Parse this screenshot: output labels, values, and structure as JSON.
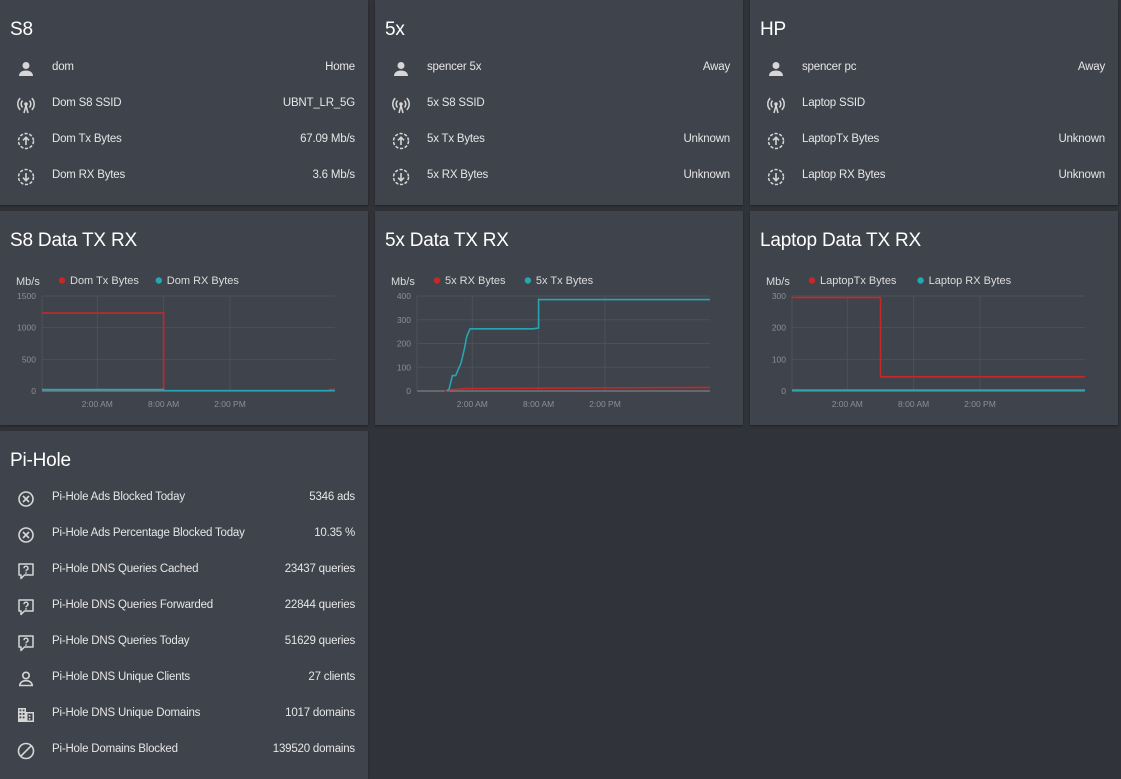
{
  "colors": {
    "tx": "#c62828",
    "rx": "#26a6b1",
    "grid": "#4c5058",
    "axis": "#8a8d93"
  },
  "cards": {
    "s8": {
      "title": "S8",
      "rows": [
        {
          "icon": "person-icon",
          "label": "dom",
          "value": "Home"
        },
        {
          "icon": "wifi-icon",
          "label": "Dom S8 SSID",
          "value": "UBNT_LR_5G"
        },
        {
          "icon": "upload-icon",
          "label": "Dom Tx Bytes",
          "value": "67.09 Mb/s"
        },
        {
          "icon": "download-icon",
          "label": "Dom RX Bytes",
          "value": "3.6 Mb/s"
        }
      ]
    },
    "fivex": {
      "title": "5x",
      "rows": [
        {
          "icon": "person-icon",
          "label": "spencer 5x",
          "value": "Away"
        },
        {
          "icon": "wifi-icon",
          "label": "5x S8 SSID",
          "value": ""
        },
        {
          "icon": "upload-icon",
          "label": "5x Tx Bytes",
          "value": "Unknown"
        },
        {
          "icon": "download-icon",
          "label": "5x RX Bytes",
          "value": "Unknown"
        }
      ]
    },
    "hp": {
      "title": "HP",
      "rows": [
        {
          "icon": "person-icon",
          "label": "spencer pc",
          "value": "Away"
        },
        {
          "icon": "wifi-icon",
          "label": "Laptop SSID",
          "value": ""
        },
        {
          "icon": "upload-icon",
          "label": "LaptopTx Bytes",
          "value": "Unknown"
        },
        {
          "icon": "download-icon",
          "label": "Laptop RX Bytes",
          "value": "Unknown"
        }
      ]
    },
    "pihole": {
      "title": "Pi-Hole",
      "rows": [
        {
          "icon": "block-circle-icon",
          "label": "Pi-Hole Ads Blocked Today",
          "value": "5346 ads"
        },
        {
          "icon": "block-circle-icon",
          "label": "Pi-Hole Ads Percentage Blocked Today",
          "value": "10.35 %"
        },
        {
          "icon": "question-bubble-icon",
          "label": "Pi-Hole DNS Queries Cached",
          "value": "23437 queries"
        },
        {
          "icon": "question-bubble-icon",
          "label": "Pi-Hole DNS Queries Forwarded",
          "value": "22844 queries"
        },
        {
          "icon": "question-bubble-icon",
          "label": "Pi-Hole DNS Queries Today",
          "value": "51629 queries"
        },
        {
          "icon": "person-outline-icon",
          "label": "Pi-Hole DNS Unique Clients",
          "value": "27 clients"
        },
        {
          "icon": "domain-icon",
          "label": "Pi-Hole DNS Unique Domains",
          "value": "1017 domains"
        },
        {
          "icon": "cancel-icon",
          "label": "Pi-Hole Domains Blocked",
          "value": "139520 domains"
        }
      ]
    }
  },
  "chart_data": [
    {
      "type": "line",
      "title": "S8 Data TX RX",
      "ylabel": "Mb/s",
      "x_axis": "time",
      "x_ticks": [
        "2:00 AM",
        "8:00 AM",
        "2:00 PM"
      ],
      "x_tick_hours": [
        2,
        8,
        14
      ],
      "x_range_hours": [
        -3,
        23.5
      ],
      "ylim": [
        0,
        1500
      ],
      "y_ticks": [
        0,
        500,
        1000,
        1500
      ],
      "series": [
        {
          "name": "Dom Tx Bytes",
          "color": "tx",
          "points": [
            [
              -3,
              1230
            ],
            [
              8,
              1230
            ],
            [
              8,
              0
            ],
            [
              23,
              0
            ],
            [
              23,
              25
            ],
            [
              23.5,
              25
            ]
          ]
        },
        {
          "name": "Dom RX Bytes",
          "color": "rx",
          "points": [
            [
              -3,
              22
            ],
            [
              8,
              22
            ],
            [
              8,
              5
            ],
            [
              23.5,
              5
            ]
          ]
        }
      ]
    },
    {
      "type": "line",
      "title": "5x Data TX RX",
      "ylabel": "Mb/s",
      "x_axis": "time",
      "x_ticks": [
        "2:00 AM",
        "8:00 AM",
        "2:00 PM"
      ],
      "x_tick_hours": [
        2,
        8,
        14
      ],
      "x_range_hours": [
        -3,
        23.5
      ],
      "ylim": [
        0,
        400
      ],
      "y_ticks": [
        0,
        100,
        200,
        300,
        400
      ],
      "series": [
        {
          "name": "5x RX Bytes",
          "color": "tx",
          "points": [
            [
              -0.5,
              0
            ],
            [
              0,
              5
            ],
            [
              1.5,
              10
            ],
            [
              8,
              12
            ],
            [
              23.5,
              15
            ]
          ]
        },
        {
          "name": "5x Tx Bytes",
          "color": "rx",
          "points": [
            [
              -0.3,
              0
            ],
            [
              -0.1,
              8
            ],
            [
              0.2,
              65
            ],
            [
              0.5,
              65
            ],
            [
              1,
              120
            ],
            [
              1.3,
              180
            ],
            [
              1.5,
              230
            ],
            [
              1.8,
              262
            ],
            [
              7.5,
              262
            ],
            [
              8,
              265
            ],
            [
              8,
              385
            ],
            [
              23.5,
              385
            ]
          ]
        }
      ]
    },
    {
      "type": "line",
      "title": "Laptop Data TX RX",
      "ylabel": "Mb/s",
      "x_axis": "time",
      "x_ticks": [
        "2:00 AM",
        "8:00 AM",
        "2:00 PM"
      ],
      "x_tick_hours": [
        2,
        8,
        14
      ],
      "x_range_hours": [
        -3,
        23.5
      ],
      "ylim": [
        0,
        300
      ],
      "y_ticks": [
        0,
        100,
        200,
        300
      ],
      "series": [
        {
          "name": "LaptopTx Bytes",
          "color": "tx",
          "points": [
            [
              -3,
              295
            ],
            [
              5,
              295
            ],
            [
              5,
              45
            ],
            [
              23.5,
              45
            ]
          ]
        },
        {
          "name": "Laptop RX Bytes",
          "color": "rx",
          "points": [
            [
              -3,
              3
            ],
            [
              23.5,
              3
            ]
          ]
        }
      ]
    }
  ]
}
